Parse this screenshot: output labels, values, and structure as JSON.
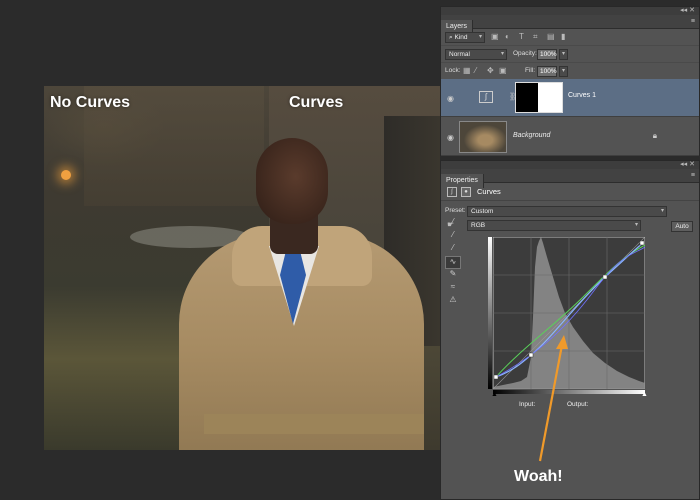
{
  "photo": {
    "left_label": "No Curves",
    "right_label": "Curves"
  },
  "layers_panel": {
    "tab": "Layers",
    "kind_filter": "Kind",
    "blend_mode": "Normal",
    "opacity_label": "Opacity:",
    "opacity_value": "100%",
    "lock_label": "Lock:",
    "fill_label": "Fill:",
    "fill_value": "100%",
    "layers": [
      {
        "name": "Curves 1",
        "selected": true
      },
      {
        "name": "Background",
        "locked": true
      }
    ]
  },
  "properties_panel": {
    "tab": "Properties",
    "title": "Curves",
    "preset_label": "Preset:",
    "preset_value": "Custom",
    "channel_value": "RGB",
    "auto_label": "Auto",
    "input_label": "Input:",
    "output_label": "Output:"
  },
  "annotation": {
    "text": "Woah!",
    "arrow_color": "#f09a2a"
  },
  "colors": {
    "panel_bg": "#535353",
    "selected_layer": "#5c6e85",
    "curve_main": "#8ab4ff",
    "curve_green": "#5ad05a"
  }
}
